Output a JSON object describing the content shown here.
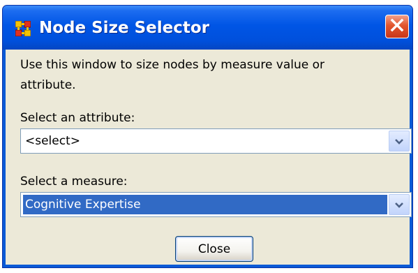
{
  "window": {
    "title": "Node Size Selector",
    "icon": "ora-network-icon",
    "close_icon": "close-icon"
  },
  "description": "Use this window to size nodes by measure value or attribute.",
  "attribute": {
    "label": "Select an attribute:",
    "value": "<select>"
  },
  "measure": {
    "label": "Select a measure:",
    "value": "Cognitive Expertise"
  },
  "buttons": {
    "close_label": "Close"
  },
  "colors": {
    "titlebar": "#0055e5",
    "close_button": "#e2562e",
    "selection": "#316ac5",
    "dialog_background": "#ece9d8"
  }
}
